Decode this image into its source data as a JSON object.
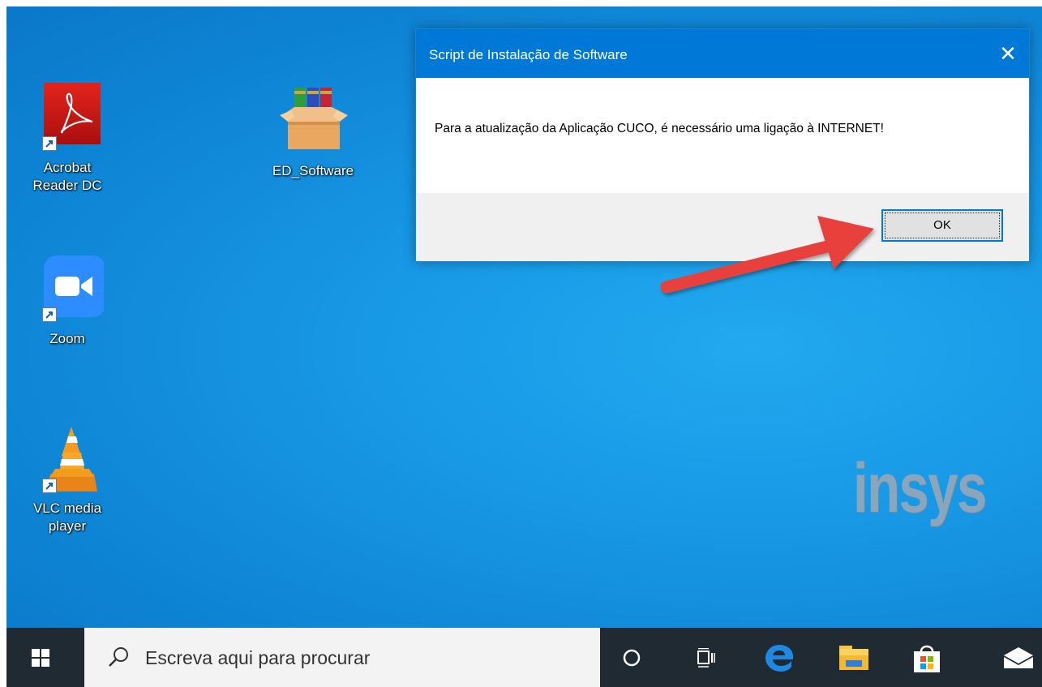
{
  "desktop": {
    "icons": [
      {
        "label": "Acrobat\nReader DC",
        "icon": "acrobat-reader-icon"
      },
      {
        "label": "ED_Software",
        "icon": "archive-box-icon"
      },
      {
        "label": "Zoom",
        "icon": "zoom-icon"
      },
      {
        "label": "VLC media\nplayer",
        "icon": "vlc-cone-icon"
      }
    ],
    "watermark": "insys"
  },
  "dialog": {
    "title": "Script de Instalação de Software",
    "close_glyph": "✕",
    "message": "Para a atualização da Aplicação CUCO, é necessário uma ligação à INTERNET!",
    "ok_label": "OK"
  },
  "taskbar": {
    "search_placeholder": "Escreva aqui para procurar",
    "icons": [
      "windows-start-icon",
      "search-glass-icon",
      "cortana-icon",
      "task-view-icon",
      "edge-icon",
      "file-explorer-icon",
      "store-icon",
      "mail-icon"
    ]
  },
  "colors": {
    "titlebar": "#0078d7",
    "desktop": "#1899e6",
    "taskbar": "#1f2a33",
    "arrow": "#e8403c"
  }
}
